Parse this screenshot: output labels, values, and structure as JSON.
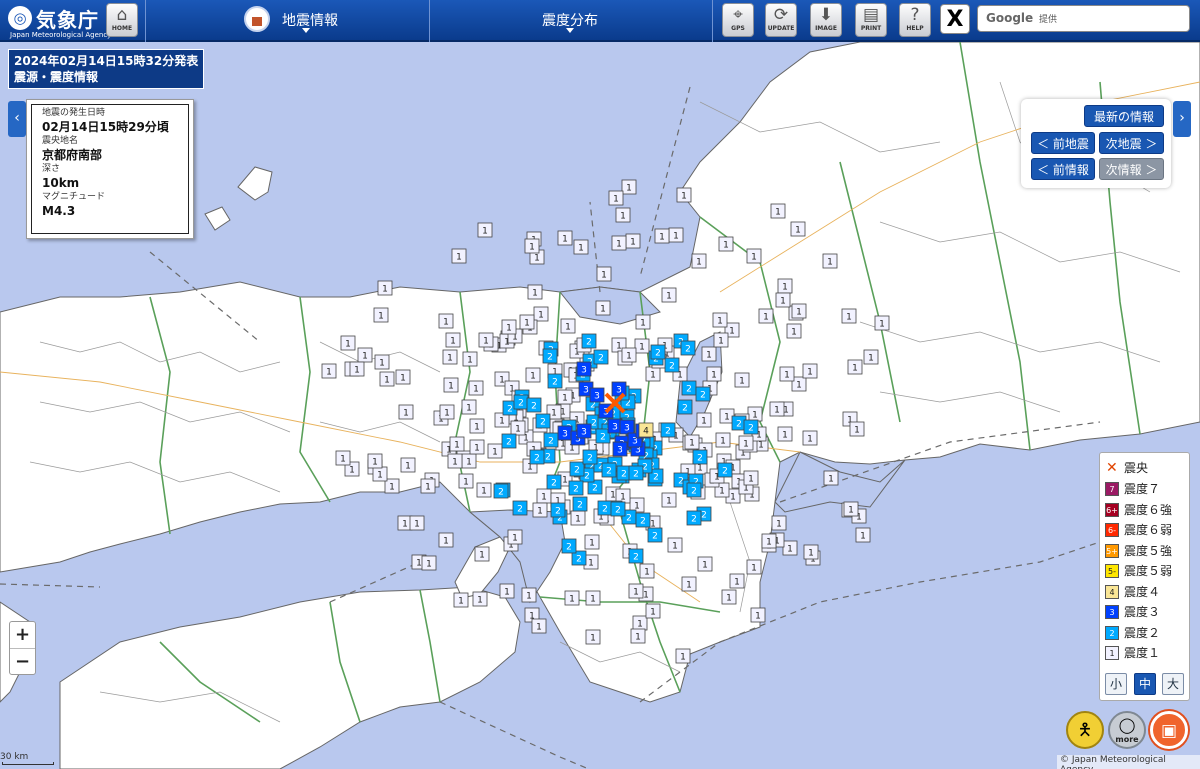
{
  "header": {
    "logo_text": "気象庁",
    "logo_en": "Japan Meteorological Agency",
    "home_label": "HOME",
    "menu1": "地震情報",
    "menu2": "震度分布",
    "tools": [
      {
        "id": "gps",
        "label": "GPS",
        "icon": "crosshair-icon"
      },
      {
        "id": "update",
        "label": "UPDATE",
        "icon": "refresh-icon"
      },
      {
        "id": "image",
        "label": "IMAGE",
        "icon": "download-icon"
      },
      {
        "id": "print",
        "label": "PRINT",
        "icon": "printer-icon"
      },
      {
        "id": "help",
        "label": "HELP",
        "icon": "question-icon"
      }
    ],
    "x_label": "X",
    "search_brand": "Google",
    "search_sub": "提供"
  },
  "title": {
    "line1": "2024年02月14日15時32分発表",
    "line2": "震源・震度情報"
  },
  "quake": {
    "time_label": "地震の発生日時",
    "time_value": "02月14日15時29分頃",
    "place_label": "震央地名",
    "place_value": "京都府南部",
    "depth_label": "深さ",
    "depth_value": "10km",
    "mag_label": "マグニチュード",
    "mag_value": "M4.3"
  },
  "nav": {
    "latest": "最新の情報",
    "prev_quake": "＜ 前地震",
    "next_quake": "次地震 ＞",
    "prev_info": "＜ 前情報",
    "next_info": "次情報 ＞"
  },
  "legend": {
    "epicenter": "震央",
    "items": [
      {
        "badge": "7",
        "label": "震度７",
        "color": "#9b1a64",
        "text": "#ffffff"
      },
      {
        "badge": "6+",
        "label": "震度６強",
        "color": "#a50021",
        "text": "#ffffff"
      },
      {
        "badge": "6-",
        "label": "震度６弱",
        "color": "#ff2800",
        "text": "#ffffff"
      },
      {
        "badge": "5+",
        "label": "震度５強",
        "color": "#ff9900",
        "text": "#ffffff"
      },
      {
        "badge": "5-",
        "label": "震度５弱",
        "color": "#ffe600",
        "text": "#222222"
      },
      {
        "badge": "4",
        "label": "震度４",
        "color": "#fae696",
        "text": "#222222"
      },
      {
        "badge": "3",
        "label": "震度３",
        "color": "#0041ff",
        "text": "#ffffff"
      },
      {
        "badge": "2",
        "label": "震度２",
        "color": "#00aaff",
        "text": "#ffffff"
      },
      {
        "badge": "1",
        "label": "震度１",
        "color": "#f2f2ff",
        "text": "#222222"
      }
    ],
    "sizes": [
      "小",
      "中",
      "大"
    ],
    "size_selected": "中"
  },
  "zoom": {
    "in": "+",
    "out": "−"
  },
  "scale_label": "30 km",
  "copyright": "© Japan Meteorological Agency",
  "bottom_buttons": [
    {
      "id": "help2",
      "icon": "help-figure-icon"
    },
    {
      "id": "more",
      "label": "more",
      "icon": "magnifier-icon"
    },
    {
      "id": "book",
      "icon": "book-icon"
    }
  ],
  "map": {
    "sea_color": "#b9c8ee",
    "land_color": "#ffffff",
    "epicenter_color": "#ff5a00"
  }
}
